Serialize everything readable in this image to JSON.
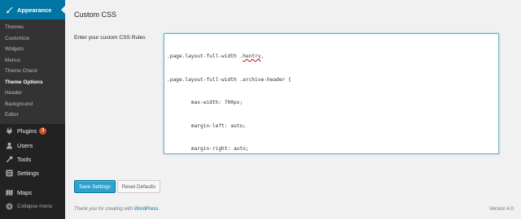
{
  "sidebar": {
    "appearance_label": "Appearance",
    "submenu": [
      {
        "label": "Themes"
      },
      {
        "label": "Customize"
      },
      {
        "label": "Widgets"
      },
      {
        "label": "Menus"
      },
      {
        "label": "Theme Check"
      },
      {
        "label": "Theme Options",
        "active": true
      },
      {
        "label": "Header"
      },
      {
        "label": "Background"
      },
      {
        "label": "Editor"
      }
    ],
    "plugins_label": "Plugins",
    "plugins_badge": "3",
    "users_label": "Users",
    "tools_label": "Tools",
    "settings_label": "Settings",
    "maps_label": "Maps",
    "collapse_label": "Collapse menu"
  },
  "main": {
    "title": "Custom CSS",
    "field_label": "Enter your custom CSS Rules",
    "css_lines": {
      "l1_prefix": ".page.layout-full-width .",
      "l1_squiggle": "hentry",
      "l1_suffix": ",",
      "l2": ".page.layout-full-width .archive-header {",
      "l3": "        max-width: 700px;",
      "l4": "        margin-left: auto;",
      "l5": "        margin-right: auto;",
      "l6": "}"
    },
    "save_button": "Save Settings",
    "reset_button": "Reset Defaults"
  },
  "footer": {
    "thanks_prefix": "Thank you for creating with ",
    "thanks_link": "WordPress",
    "thanks_suffix": ".",
    "version": "Version 4.0"
  },
  "colors": {
    "accent": "#0074a2",
    "sidebar_bg": "#222222",
    "button_primary": "#2ea2cc",
    "badge": "#d54e21"
  }
}
